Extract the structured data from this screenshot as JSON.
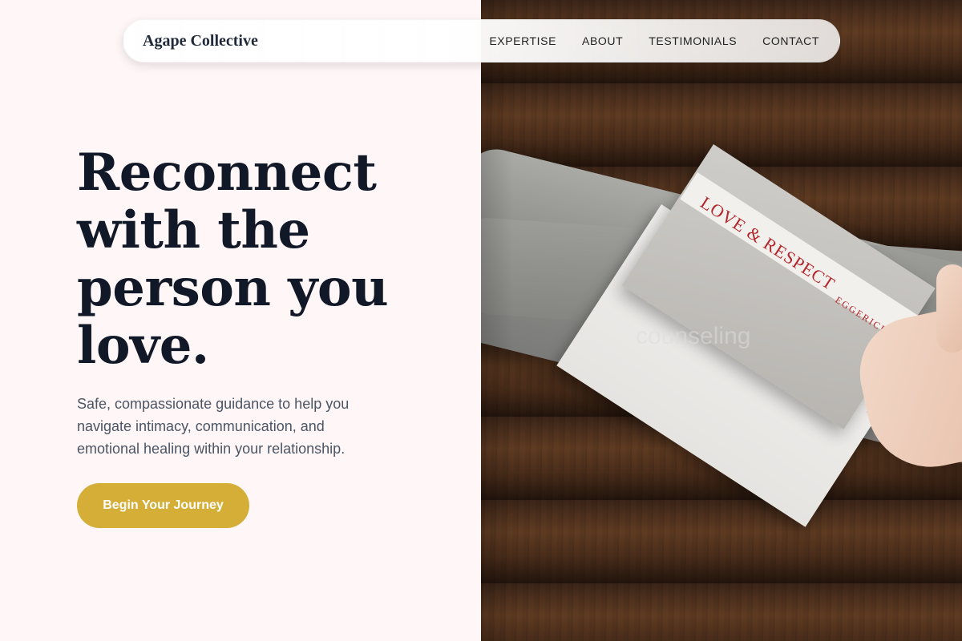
{
  "nav": {
    "brand": "Agape Collective",
    "links": [
      "EXPERTISE",
      "ABOUT",
      "TESTIMONIALS",
      "CONTACT"
    ]
  },
  "hero": {
    "title_lines": [
      "Reconnect",
      "with the",
      "person you",
      "love."
    ],
    "subtitle": "Safe, compassionate guidance to help you navigate intimacy, communication, and emotional healing within your relationship.",
    "cta_label": "Begin Your Journey"
  },
  "photo": {
    "alt_text": "counseling",
    "book_title": "LOVE & RESPECT",
    "book_author": "EGGERICHS"
  },
  "colors": {
    "page_background": "#fff7f7",
    "accent": "#d4ae36",
    "heading": "#111827",
    "body_text": "#4b5563"
  }
}
